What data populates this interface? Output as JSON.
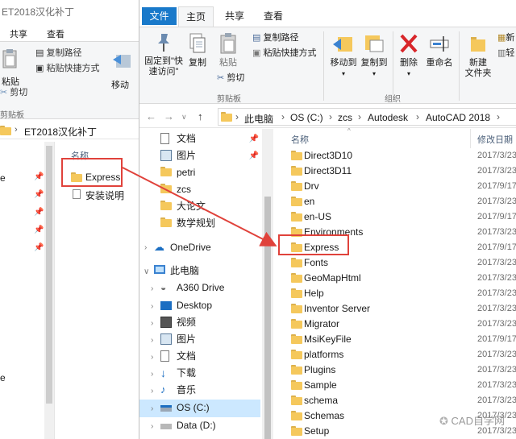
{
  "back_window": {
    "title": "ET2018汉化补丁",
    "tabs": [
      "共享",
      "查看"
    ],
    "ribbon": {
      "paste": "粘贴",
      "copy_path": "复制路径",
      "paste_shortcut": "粘贴快捷方式",
      "cut": "剪切",
      "move_to": "移动",
      "group_clipboard": "剪贴板"
    },
    "breadcrumb": "ET2018汉化补丁",
    "column_name": "名称",
    "files": [
      {
        "name": "Express",
        "type": "folder"
      },
      {
        "name": "安装说明",
        "type": "doc"
      }
    ],
    "nav_partial": [
      "e",
      "e"
    ]
  },
  "front_window": {
    "tabs": [
      "文件",
      "主页",
      "共享",
      "查看"
    ],
    "active_tab": "主页",
    "ribbon": {
      "pin": "固定到\"快\n速访问\"",
      "copy": "复制",
      "paste": "粘贴",
      "copy_path": "复制路径",
      "paste_shortcut": "粘贴快捷方式",
      "cut": "剪切",
      "move_to": "移动到",
      "copy_to": "复制到",
      "delete": "删除",
      "rename": "重命名",
      "new_folder": "新建\n文件夹",
      "new_item_partial": "新",
      "easy_access_partial": "轻",
      "group_clipboard": "剪贴板",
      "group_organize": "组织"
    },
    "address": {
      "crumbs": [
        "此电脑",
        "OS (C:)",
        "zcs",
        "Autodesk",
        "AutoCAD 2018"
      ]
    },
    "nav": [
      {
        "label": "文档",
        "icon": "document-icon",
        "pinned": true
      },
      {
        "label": "图片",
        "icon": "pictures-icon",
        "pinned": true
      },
      {
        "label": "petri",
        "icon": "folder-icon",
        "pinned": false
      },
      {
        "label": "zcs",
        "icon": "folder-icon",
        "pinned": false
      },
      {
        "label": "大论文",
        "icon": "folder-icon",
        "pinned": false
      },
      {
        "label": "数学规划",
        "icon": "folder-icon",
        "pinned": false
      },
      {
        "label": "OneDrive",
        "icon": "onedrive-icon",
        "pinned": false
      },
      {
        "label": "此电脑",
        "icon": "computer-icon",
        "pinned": false
      },
      {
        "label": "A360 Drive",
        "icon": "a360-icon",
        "pinned": false
      },
      {
        "label": "Desktop",
        "icon": "desktop-icon",
        "pinned": false
      },
      {
        "label": "视频",
        "icon": "video-icon",
        "pinned": false
      },
      {
        "label": "图片",
        "icon": "pictures-icon",
        "pinned": false
      },
      {
        "label": "文档",
        "icon": "document-icon",
        "pinned": false
      },
      {
        "label": "下载",
        "icon": "download-icon",
        "pinned": false
      },
      {
        "label": "音乐",
        "icon": "music-icon",
        "pinned": false
      },
      {
        "label": "OS (C:)",
        "icon": "drive-icon",
        "pinned": false
      },
      {
        "label": "Data (D:)",
        "icon": "drive-icon",
        "pinned": false
      }
    ],
    "columns": {
      "name": "名称",
      "date": "修改日期"
    },
    "files": [
      {
        "name": "Direct3D10",
        "date": "2017/3/23"
      },
      {
        "name": "Direct3D11",
        "date": "2017/3/23"
      },
      {
        "name": "Drv",
        "date": "2017/9/17"
      },
      {
        "name": "en",
        "date": "2017/3/23"
      },
      {
        "name": "en-US",
        "date": "2017/9/17"
      },
      {
        "name": "Environments",
        "date": "2017/3/23"
      },
      {
        "name": "Express",
        "date": "2017/9/17"
      },
      {
        "name": "Fonts",
        "date": "2017/3/23"
      },
      {
        "name": "GeoMapHtml",
        "date": "2017/3/23"
      },
      {
        "name": "Help",
        "date": "2017/3/23"
      },
      {
        "name": "Inventor Server",
        "date": "2017/3/23"
      },
      {
        "name": "Migrator",
        "date": "2017/3/23"
      },
      {
        "name": "MsiKeyFile",
        "date": "2017/9/17"
      },
      {
        "name": "platforms",
        "date": "2017/3/23"
      },
      {
        "name": "Plugins",
        "date": "2017/3/23"
      },
      {
        "name": "Sample",
        "date": "2017/3/23"
      },
      {
        "name": "schema",
        "date": "2017/3/23"
      },
      {
        "name": "Schemas",
        "date": "2017/3/23"
      },
      {
        "name": "Setup",
        "date": "2017/3/23"
      }
    ]
  },
  "watermark": "CAD自学网",
  "colors": {
    "accent": "#1979ca",
    "highlight": "#e0423b",
    "selection": "#cce8ff",
    "folder": "#f5c85c"
  }
}
